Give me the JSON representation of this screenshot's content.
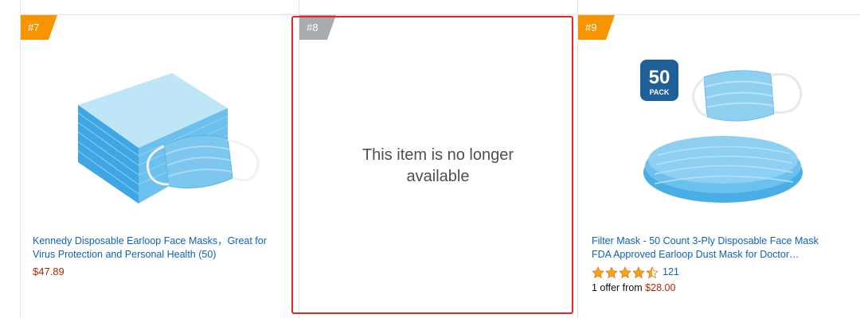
{
  "products": [
    {
      "rank": "#7",
      "title_line1": "Kennedy Disposable Earloop Face Masks，Great for",
      "title_line2": "Virus Protection and Personal Health (50)",
      "price": "$47.89"
    },
    {
      "rank": "#8",
      "unavailable_line1": "This item is no longer",
      "unavailable_line2": "available"
    },
    {
      "rank": "#9",
      "title_line1": "Filter Mask - 50 Count 3-Ply Disposable Face Mask",
      "title_line2": "FDA Approved Earloop Dust Mask for Doctor…",
      "badge_number": "50",
      "badge_text": "PACK",
      "rating": 4.5,
      "rating_count": "121",
      "offer_text": "1 offer from ",
      "offer_price": "$28.00"
    }
  ],
  "colors": {
    "rank_orange": "#f79400",
    "rank_gray": "#a9acaf",
    "link_blue": "#0e62b9",
    "price_red": "#b12704",
    "highlight_red": "#e3262b",
    "star_orange": "#f4a41c"
  }
}
